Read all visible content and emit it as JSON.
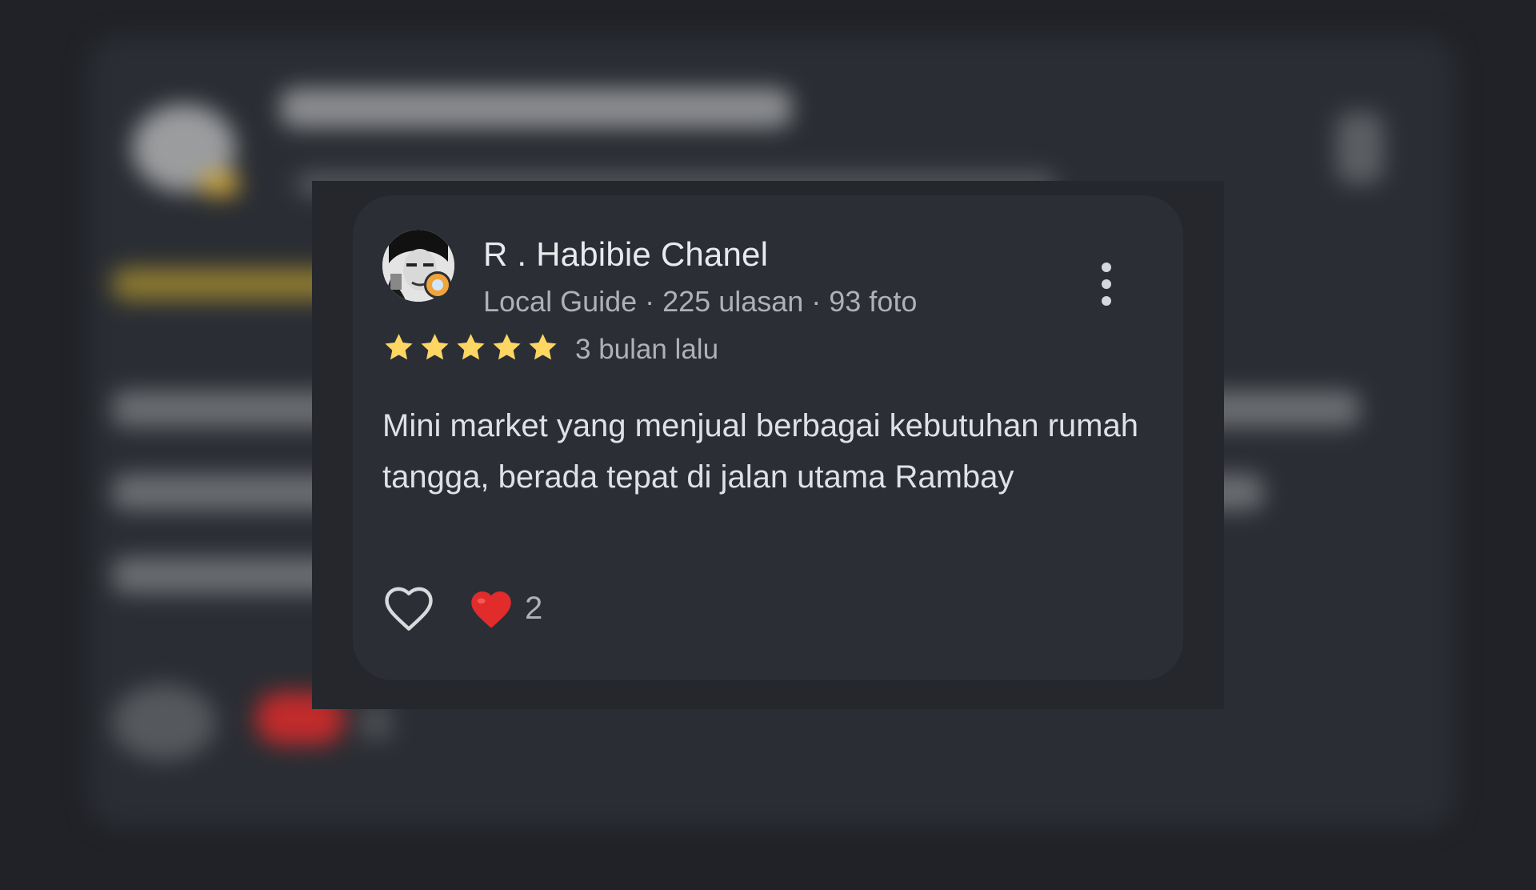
{
  "review": {
    "reviewer_name": "R . Habibie Chanel",
    "reviewer_meta": "Local Guide · 225 ulasan · 93 foto",
    "rating": 5,
    "rating_max": 5,
    "time": "3 bulan lalu",
    "text": "Mini market yang menjual berbagai kebutuhan rumah tangga, berada tepat di jalan utama Rambay",
    "reaction_count": "2"
  },
  "icons": {
    "menu": "more-vert-icon",
    "like": "heart-outline-icon",
    "reaction": "red-heart-icon",
    "star": "star-icon",
    "badge": "local-guide-badge-icon"
  },
  "colors": {
    "star": "#FDD663",
    "reaction_heart": "#E22B2B",
    "card_background": "#2B2E35",
    "frame_background": "#25272C",
    "text_primary": "#E8EAED",
    "text_secondary": "#AEB1B6"
  }
}
